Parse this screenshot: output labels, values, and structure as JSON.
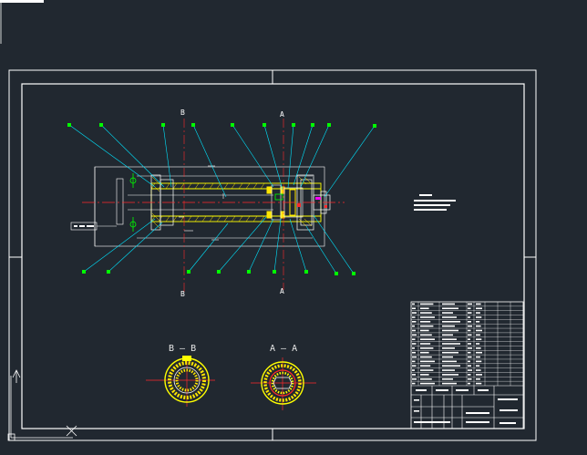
{
  "section_views": [
    {
      "id": "B-B",
      "label": "B — B"
    },
    {
      "id": "A-A",
      "label": "A — A"
    }
  ],
  "cutting_planes": {
    "a_top": "A",
    "a_bottom": "A",
    "b_top": "B",
    "b_bottom": "B"
  },
  "colors": {
    "background": "#212830",
    "frame": "#ffffff",
    "leader": "#00e5ff",
    "balloon": "#00ff00",
    "centerline": "#ff2a2a",
    "part": "#ffff00",
    "hatch": "#ffe600",
    "accent": "#ff00ff"
  }
}
